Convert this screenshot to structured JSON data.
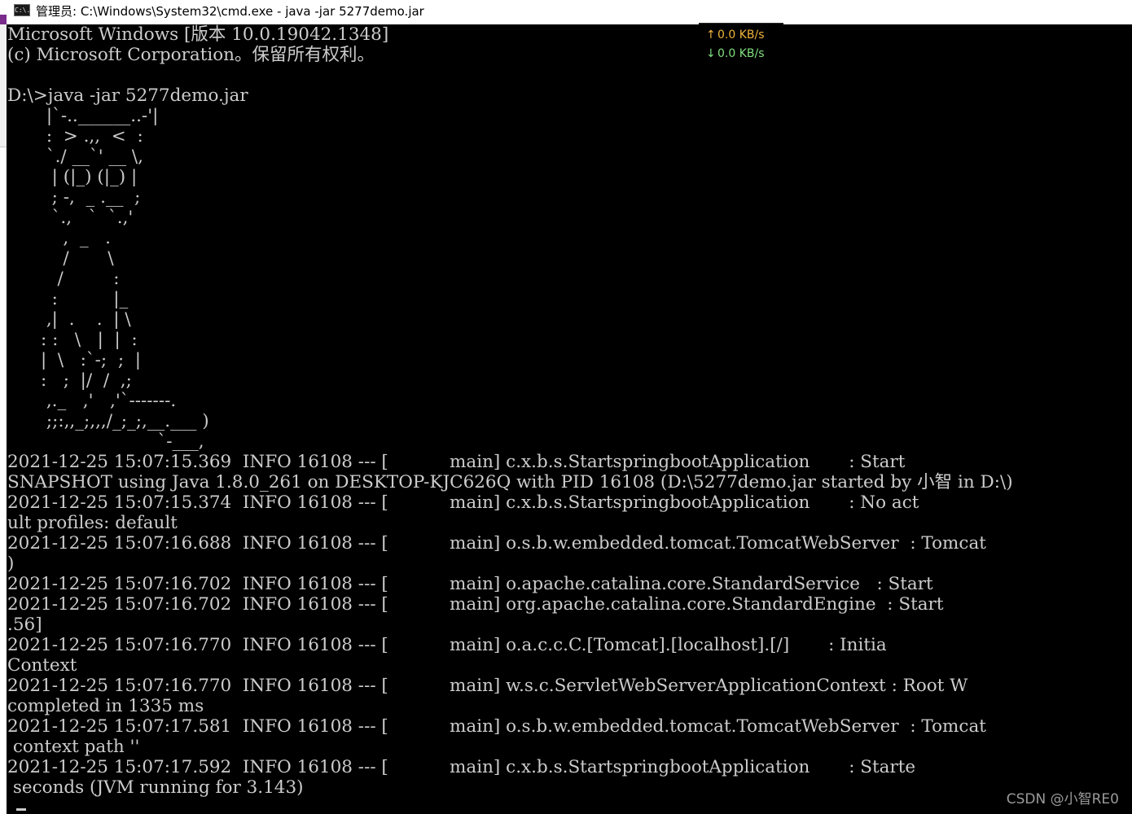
{
  "window": {
    "title": "管理员: C:\\Windows\\System32\\cmd.exe - java  -jar 5277demo.jar",
    "icon": "cmd-icon",
    "icon_text": "C:\\."
  },
  "network_monitor": {
    "upload_arrow": "↑",
    "upload": "0.0 KB/s",
    "download_arrow": "↓",
    "download": "0.0 KB/s",
    "upload_color": "#f0b43c",
    "download_color": "#7ee07e"
  },
  "console": {
    "lines": [
      "Microsoft Windows [版本 10.0.19042.1348]",
      "(c) Microsoft Corporation。保留所有权利。",
      "",
      "D:\\>java -jar 5277demo.jar",
      "       |`-..______..-'|",
      "       :  > .,,  <  :",
      "       `./ __`' __ \\,",
      "        | (|_) (|_) |",
      "        ; -,  _ .__  ;",
      "        `.,   `  `.,'",
      "          ,  _   .",
      "          /       \\",
      "         /         :",
      "        :          |_",
      "       ,|  .    .  | \\",
      "      : :   \\   |  |  :",
      "      |  \\   :`-;  ;  |",
      "      :   ;  |/  /  ,;",
      "       ,._   ,'   ,'`-------.",
      "       ;;:,,_;,,,/_;_;,__.___ )",
      "                           `-___,",
      "2021-12-25 15:07:15.369  INFO 16108 --- [           main] c.x.b.s.StartspringbootApplication       : Start",
      "SNAPSHOT using Java 1.8.0_261 on DESKTOP-KJC626Q with PID 16108 (D:\\5277demo.jar started by 小智 in D:\\)",
      "2021-12-25 15:07:15.374  INFO 16108 --- [           main] c.x.b.s.StartspringbootApplication       : No act",
      "ult profiles: default",
      "2021-12-25 15:07:16.688  INFO 16108 --- [           main] o.s.b.w.embedded.tomcat.TomcatWebServer  : Tomcat",
      ")",
      "2021-12-25 15:07:16.702  INFO 16108 --- [           main] o.apache.catalina.core.StandardService   : Start",
      "2021-12-25 15:07:16.702  INFO 16108 --- [           main] org.apache.catalina.core.StandardEngine  : Start",
      ".56]",
      "2021-12-25 15:07:16.770  INFO 16108 --- [           main] o.a.c.c.C.[Tomcat].[localhost].[/]       : Initia",
      "Context",
      "2021-12-25 15:07:16.770  INFO 16108 --- [           main] w.s.c.ServletWebServerApplicationContext : Root W",
      "completed in 1335 ms",
      "2021-12-25 15:07:17.581  INFO 16108 --- [           main] o.s.b.w.embedded.tomcat.TomcatWebServer  : Tomcat",
      " context path ''",
      "2021-12-25 15:07:17.592  INFO 16108 --- [           main] c.x.b.s.StartspringbootApplication       : Starte",
      " seconds (JVM running for 3.143)"
    ]
  },
  "watermark": "CSDN @小智RE0",
  "colors": {
    "console_background": "#000000",
    "console_text": "#cccccc",
    "titlebar_background": "#ffffff",
    "accent": "#7a2c8c"
  }
}
